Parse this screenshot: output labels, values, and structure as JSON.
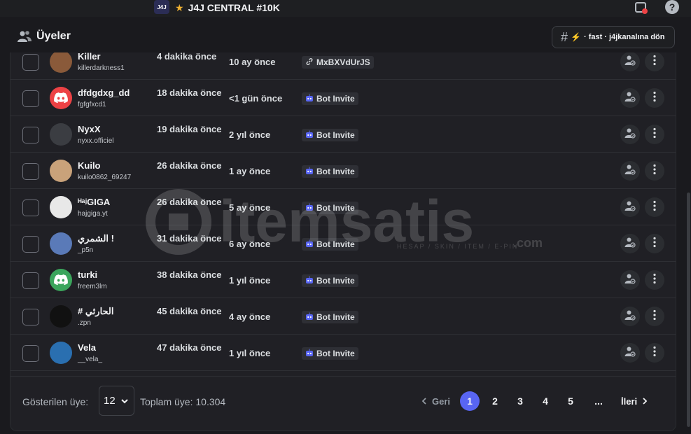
{
  "titlebar": {
    "server_icon_text": "J4J",
    "star": "★",
    "title": "J4J CENTRAL #10K",
    "help_icon": "?"
  },
  "header": {
    "title": "Üyeler",
    "back_hash": "#",
    "back_bolt": "⚡",
    "back_label": "· fast · j4jkanalına dön"
  },
  "colors": {
    "accent": "#5865f2",
    "background": "#1a1a1e",
    "panel": "#202025",
    "discord_red": "#ed4245",
    "discord_green": "#3ba55c"
  },
  "members": [
    {
      "display_name": "Killer",
      "username": "killerdarkness1",
      "joined": "4 dakika önce",
      "account_age": "10 ay önce",
      "method_label": "MxBXVdUrJS",
      "method_icon": "link-icon",
      "avatar_icon": "avatar-image",
      "avatar_color": "#8a5a3a"
    },
    {
      "display_name": "dfdgdxg_dd",
      "username": "fgfgfxcd1",
      "joined": "18 dakika önce",
      "account_age": "<1 gün önce",
      "method_label": "Bot Invite",
      "method_icon": "bot-icon",
      "avatar_icon": "discord-logo-icon",
      "avatar_color": "#ed4245"
    },
    {
      "display_name": "NyxX",
      "username": "nyxx.officiel",
      "joined": "19 dakika önce",
      "account_age": "2 yıl önce",
      "method_label": "Bot Invite",
      "method_icon": "bot-icon",
      "avatar_icon": "avatar-image",
      "avatar_color": "#3b3d42"
    },
    {
      "display_name": "Kuilo",
      "username": "kuilo0862_69247",
      "joined": "26 dakika önce",
      "account_age": "1 ay önce",
      "method_label": "Bot Invite",
      "method_icon": "bot-icon",
      "avatar_icon": "avatar-image",
      "avatar_color": "#c9a27a"
    },
    {
      "display_name": "ᴴᵃʲGIGA",
      "username": "hajgiga.yt",
      "joined": "26 dakika önce",
      "account_age": "5 ay önce",
      "method_label": "Bot Invite",
      "method_icon": "bot-icon",
      "avatar_icon": "avatar-image",
      "avatar_color": "#e8e8e8"
    },
    {
      "display_name": "الشمري !",
      "username": "_p5n",
      "joined": "31 dakika önce",
      "account_age": "6 ay önce",
      "method_label": "Bot Invite",
      "method_icon": "bot-icon",
      "avatar_icon": "avatar-image",
      "avatar_color": "#5a7ab8"
    },
    {
      "display_name": "turki",
      "username": "freem3lm",
      "joined": "38 dakika önce",
      "account_age": "1 yıl önce",
      "method_label": "Bot Invite",
      "method_icon": "bot-icon",
      "avatar_icon": "discord-logo-icon",
      "avatar_color": "#3ba55c"
    },
    {
      "display_name": "# الحارثي",
      "username": ".zpn",
      "joined": "45 dakika önce",
      "account_age": "4 ay önce",
      "method_label": "Bot Invite",
      "method_icon": "bot-icon",
      "avatar_icon": "avatar-image",
      "avatar_color": "#111111"
    },
    {
      "display_name": "Vela",
      "username": "__vela_",
      "joined": "47 dakika önce",
      "account_age": "1 yıl önce",
      "method_label": "Bot Invite",
      "method_icon": "bot-icon",
      "avatar_icon": "avatar-image",
      "avatar_color": "#2a6fb0"
    }
  ],
  "footer": {
    "shown_label": "Gösterilen üye:",
    "page_size": "12",
    "total_label": "Toplam üye: 10.304",
    "prev_label": "Geri",
    "next_label": "İleri",
    "pages": [
      "1",
      "2",
      "3",
      "4",
      "5"
    ],
    "active_page": "1",
    "ellipsis": "..."
  },
  "watermark": {
    "text": "itemsatis",
    "sub": "HESAP / SKIN / ITEM / E-PIN",
    "domain": ".com"
  }
}
